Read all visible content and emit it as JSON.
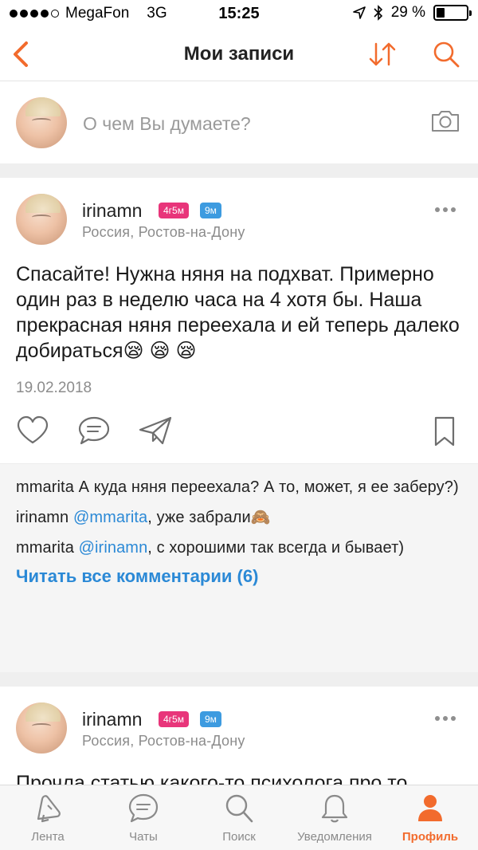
{
  "status_bar": {
    "carrier": "MegaFon",
    "network": "3G",
    "time": "15:25",
    "battery": "29 %",
    "battery_level": 0.29
  },
  "nav": {
    "title": "Мои записи",
    "accent_color": "#f26b2d"
  },
  "composer": {
    "placeholder": "О чем Вы думаете?"
  },
  "posts": [
    {
      "username": "irinamn",
      "badge_child_age": "4г5м",
      "badge_child_age2": "9м",
      "location": "Россия, Ростов-на-Дону",
      "text": "Спасайте! Нужна няня на подхват. Примерно один раз в неделю часа на 4 хотя бы. Наша прекрасная няня переехала и ей теперь далеко добираться😪 😪 😪",
      "date": "19.02.2018",
      "comments": [
        {
          "author": "mmarita",
          "mention": "",
          "text": "А куда няня переехала? А то, может, я ее заберу?)"
        },
        {
          "author": "irinamn",
          "mention": "@mmarita",
          "text": ", уже забрали🙈"
        },
        {
          "author": "mmarita",
          "mention": "@irinamn",
          "text": ", с хорошими так всегда и бывает)"
        }
      ],
      "read_all": "Читать все комментарии (6)"
    },
    {
      "username": "irinamn",
      "badge_child_age": "4г5м",
      "badge_child_age2": "9м",
      "location": "Россия, Ростов-на-Дону",
      "text": "Прочла статью какого-то психолога про то,"
    }
  ],
  "tabs": [
    {
      "label": "Лента",
      "icon": "feed-icon"
    },
    {
      "label": "Чаты",
      "icon": "chat-icon"
    },
    {
      "label": "Поиск",
      "icon": "search-icon"
    },
    {
      "label": "Уведомления",
      "icon": "bell-icon"
    },
    {
      "label": "Профиль",
      "icon": "profile-icon",
      "active": true
    }
  ]
}
